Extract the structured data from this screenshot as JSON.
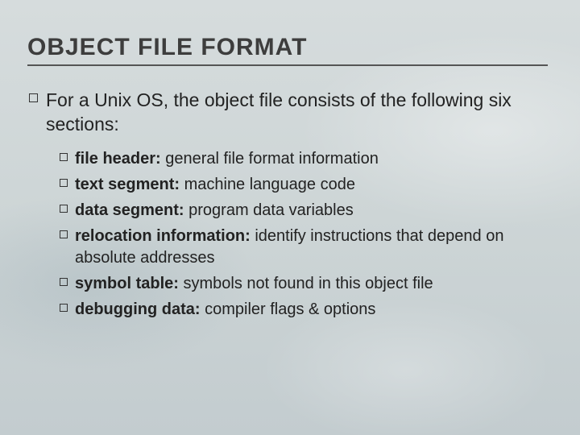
{
  "title": "OBJECT FILE FORMAT",
  "lead": "For a Unix OS, the object file consists of the following six sections:",
  "items": [
    {
      "bold": "file header:",
      "rest": " general file format information"
    },
    {
      "bold": "text segment:",
      "rest": " machine language code"
    },
    {
      "bold": "data segment:",
      "rest": " program data variables"
    },
    {
      "bold": "relocation information:",
      "rest": " identify instructions that depend on absolute addresses"
    },
    {
      "bold": "symbol table:",
      "rest": " symbols not found in this object file"
    },
    {
      "bold": "debugging data:",
      "rest": " compiler flags & options"
    }
  ]
}
